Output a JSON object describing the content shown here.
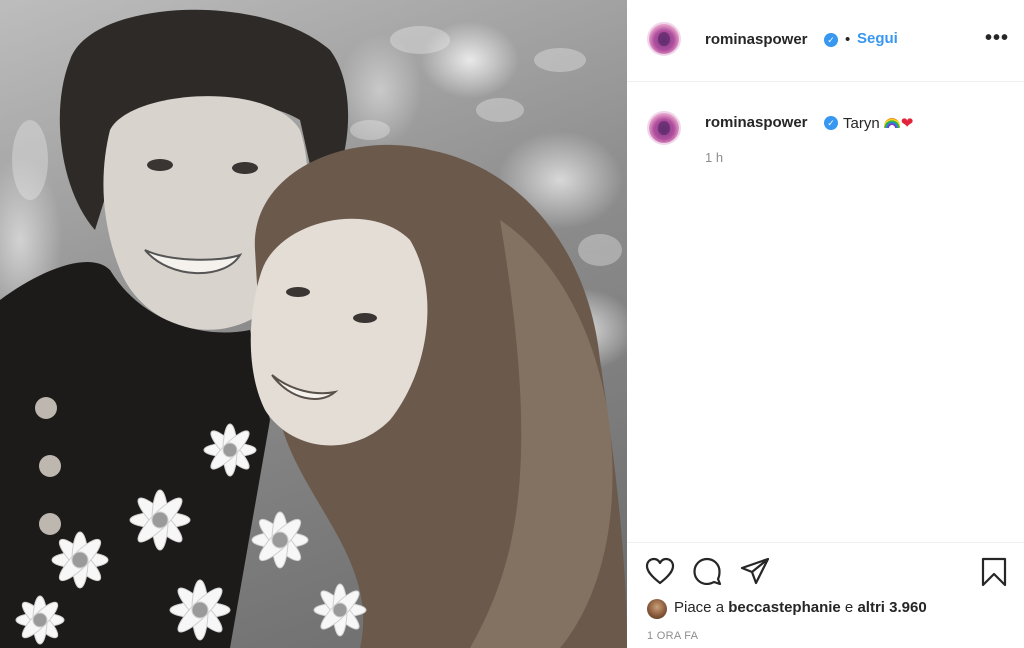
{
  "post": {
    "photo_alt": "black and white photo of a couple with a bouquet of daisies"
  },
  "header": {
    "username": "rominaspower",
    "verified_icon": "verified-badge-icon",
    "dot": "•",
    "follow_label": "Segui",
    "more_label": "•••"
  },
  "caption": {
    "username": "rominaspower",
    "text": "Taryn",
    "emojis": [
      "rainbow-icon",
      "red-heart-icon"
    ],
    "heart_glyph": "❤",
    "time": "1 h"
  },
  "actions": {
    "icons": [
      "heart-icon",
      "comment-icon",
      "share-icon",
      "bookmark-icon"
    ]
  },
  "likes": {
    "prefix": "Piace a ",
    "user": "beccastephanie",
    "middle": " e ",
    "count": "altri 3.960"
  },
  "timestamp": "1 ORA FA",
  "colors": {
    "accent": "#3897f0",
    "text": "#262626",
    "muted": "#8e8e8e",
    "border": "#efefef"
  }
}
